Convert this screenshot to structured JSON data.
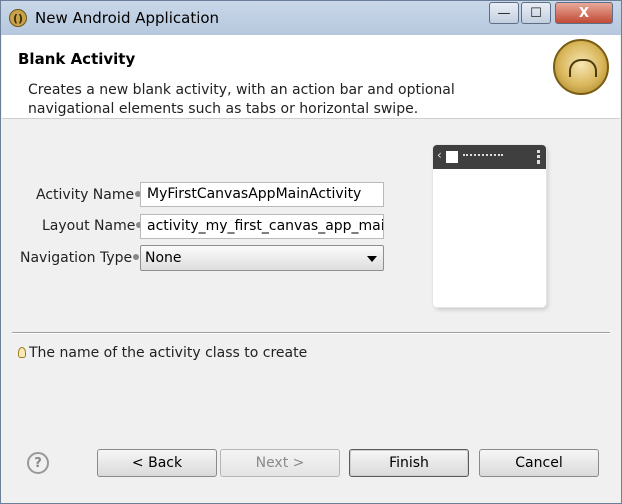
{
  "window": {
    "title": "New Android Application"
  },
  "title_buttons": {
    "minimize": "—",
    "maximize": "☐",
    "close": "X"
  },
  "header": {
    "title": "Blank Activity",
    "description": "Creates a new blank activity, with an action bar and optional navigational elements such as tabs or horizontal swipe."
  },
  "form": {
    "activity_name_label": "Activity Name",
    "activity_name_value": "MyFirstCanvasAppMainActivity",
    "layout_name_label": "Layout Name",
    "layout_name_value": "activity_my_first_canvas_app_main",
    "navigation_type_label": "Navigation Type",
    "navigation_type_value": "None"
  },
  "hint": {
    "text": "The name of the activity class to create"
  },
  "buttons": {
    "help": "?",
    "back": "< Back",
    "next": "Next >",
    "finish": "Finish",
    "cancel": "Cancel"
  }
}
